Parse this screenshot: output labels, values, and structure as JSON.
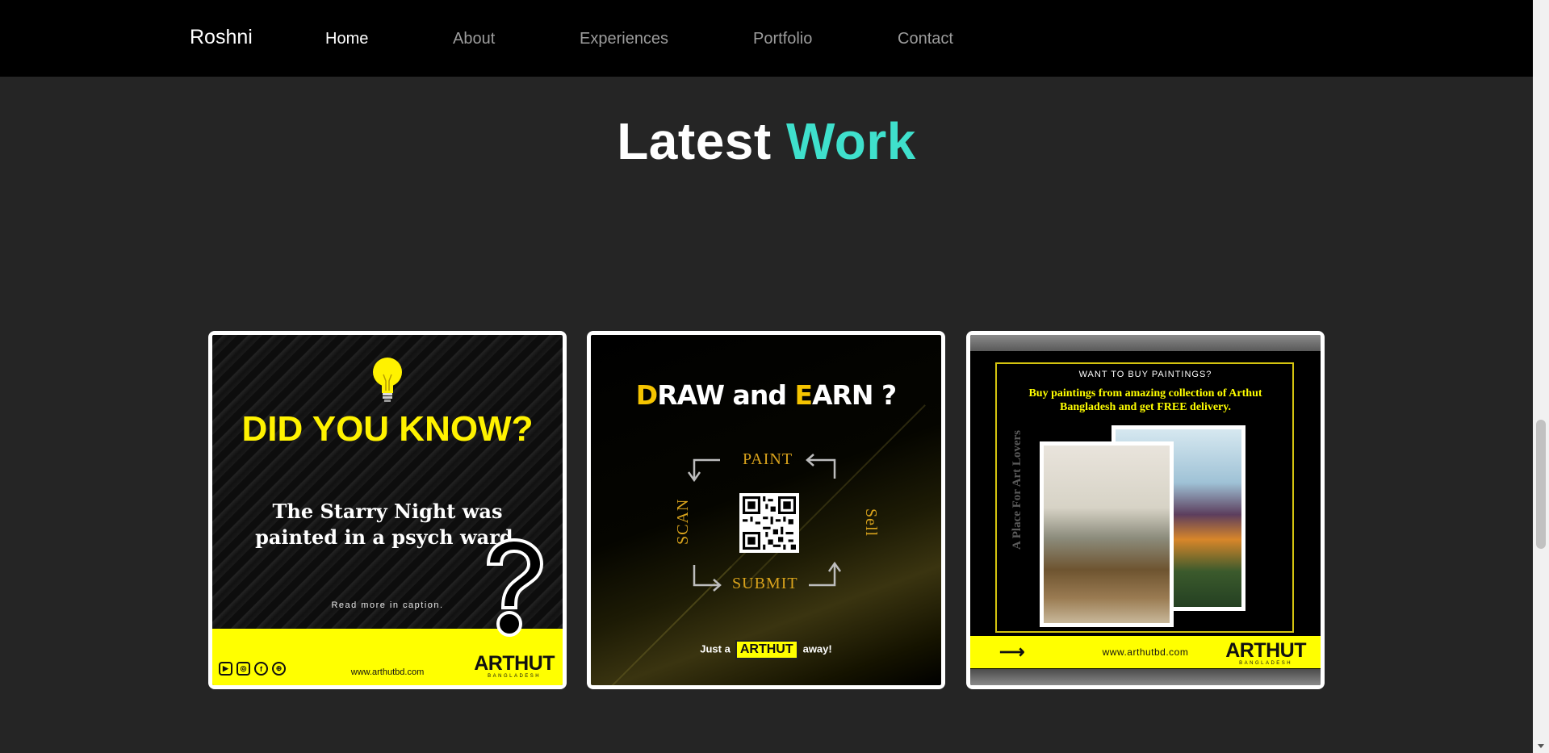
{
  "navbar": {
    "brand": "Roshni",
    "links": [
      {
        "label": "Home",
        "active": true
      },
      {
        "label": "About",
        "active": false
      },
      {
        "label": "Experiences",
        "active": false
      },
      {
        "label": "Portfolio",
        "active": false
      },
      {
        "label": "Contact",
        "active": false
      }
    ]
  },
  "section": {
    "title_main": "Latest",
    "title_accent": "Work",
    "accent_color": "#3fe0cc"
  },
  "cards": [
    {
      "headline": "DID YOU KNOW?",
      "fact": "The Starry Night was painted in a psych ward.",
      "caption": "Read more in caption.",
      "url": "www.arthutbd.com",
      "logo": "ARTHUT",
      "logo_sub": "BANGLADESH",
      "social_icons": [
        "youtube-icon",
        "instagram-icon",
        "facebook-icon",
        "globe-icon"
      ]
    },
    {
      "title_d": "D",
      "title_mid": "RAW and ",
      "title_e": "E",
      "title_end": "ARN ?",
      "steps": {
        "paint": "PAINT",
        "scan": "SCAN",
        "sell": "Sell",
        "submit": "SUBMIT"
      },
      "just_a": "Just a",
      "logo": "ARTHUT",
      "away": "away!"
    },
    {
      "kicker": "WANT TO BUY PAINTINGS?",
      "text": "Buy paintings from amazing collection of Arthut Bangladesh and get FREE delivery.",
      "tagline": "A Place For Art Lovers",
      "url": "www.arthutbd.com",
      "logo": "ARTHUT",
      "logo_sub": "BANGLADESH"
    }
  ],
  "colors": {
    "brand_yellow": "#ffff00",
    "nav_bg": "#000000",
    "page_bg": "#252525"
  }
}
